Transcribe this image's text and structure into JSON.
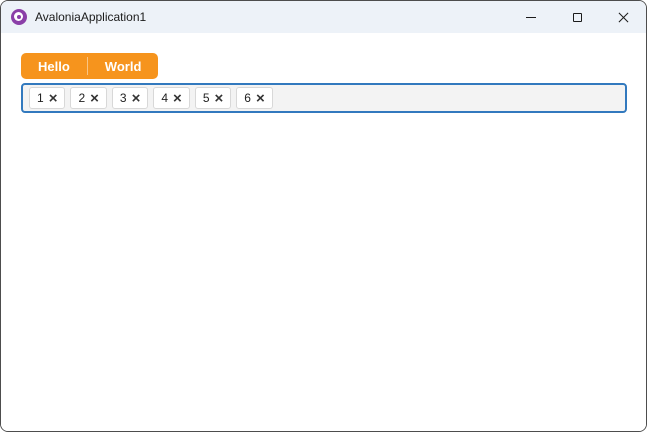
{
  "window": {
    "title": "AvaloniaApplication1",
    "controls": {
      "minimize": "minimize",
      "maximize": "maximize",
      "close": "close"
    }
  },
  "colors": {
    "accent_orange": "#f6941d",
    "tagbox_border_blue": "#3279be",
    "titlebar_bg": "#edf2f8",
    "chip_border": "#d8d8d8",
    "logo_purple": "#8b3fa8"
  },
  "toolbar": {
    "hello_label": "Hello",
    "world_label": "World"
  },
  "tags_input": {
    "remove_glyph": "×",
    "chips": [
      {
        "label": "1"
      },
      {
        "label": "2"
      },
      {
        "label": "3"
      },
      {
        "label": "4"
      },
      {
        "label": "5"
      },
      {
        "label": "6"
      }
    ]
  }
}
